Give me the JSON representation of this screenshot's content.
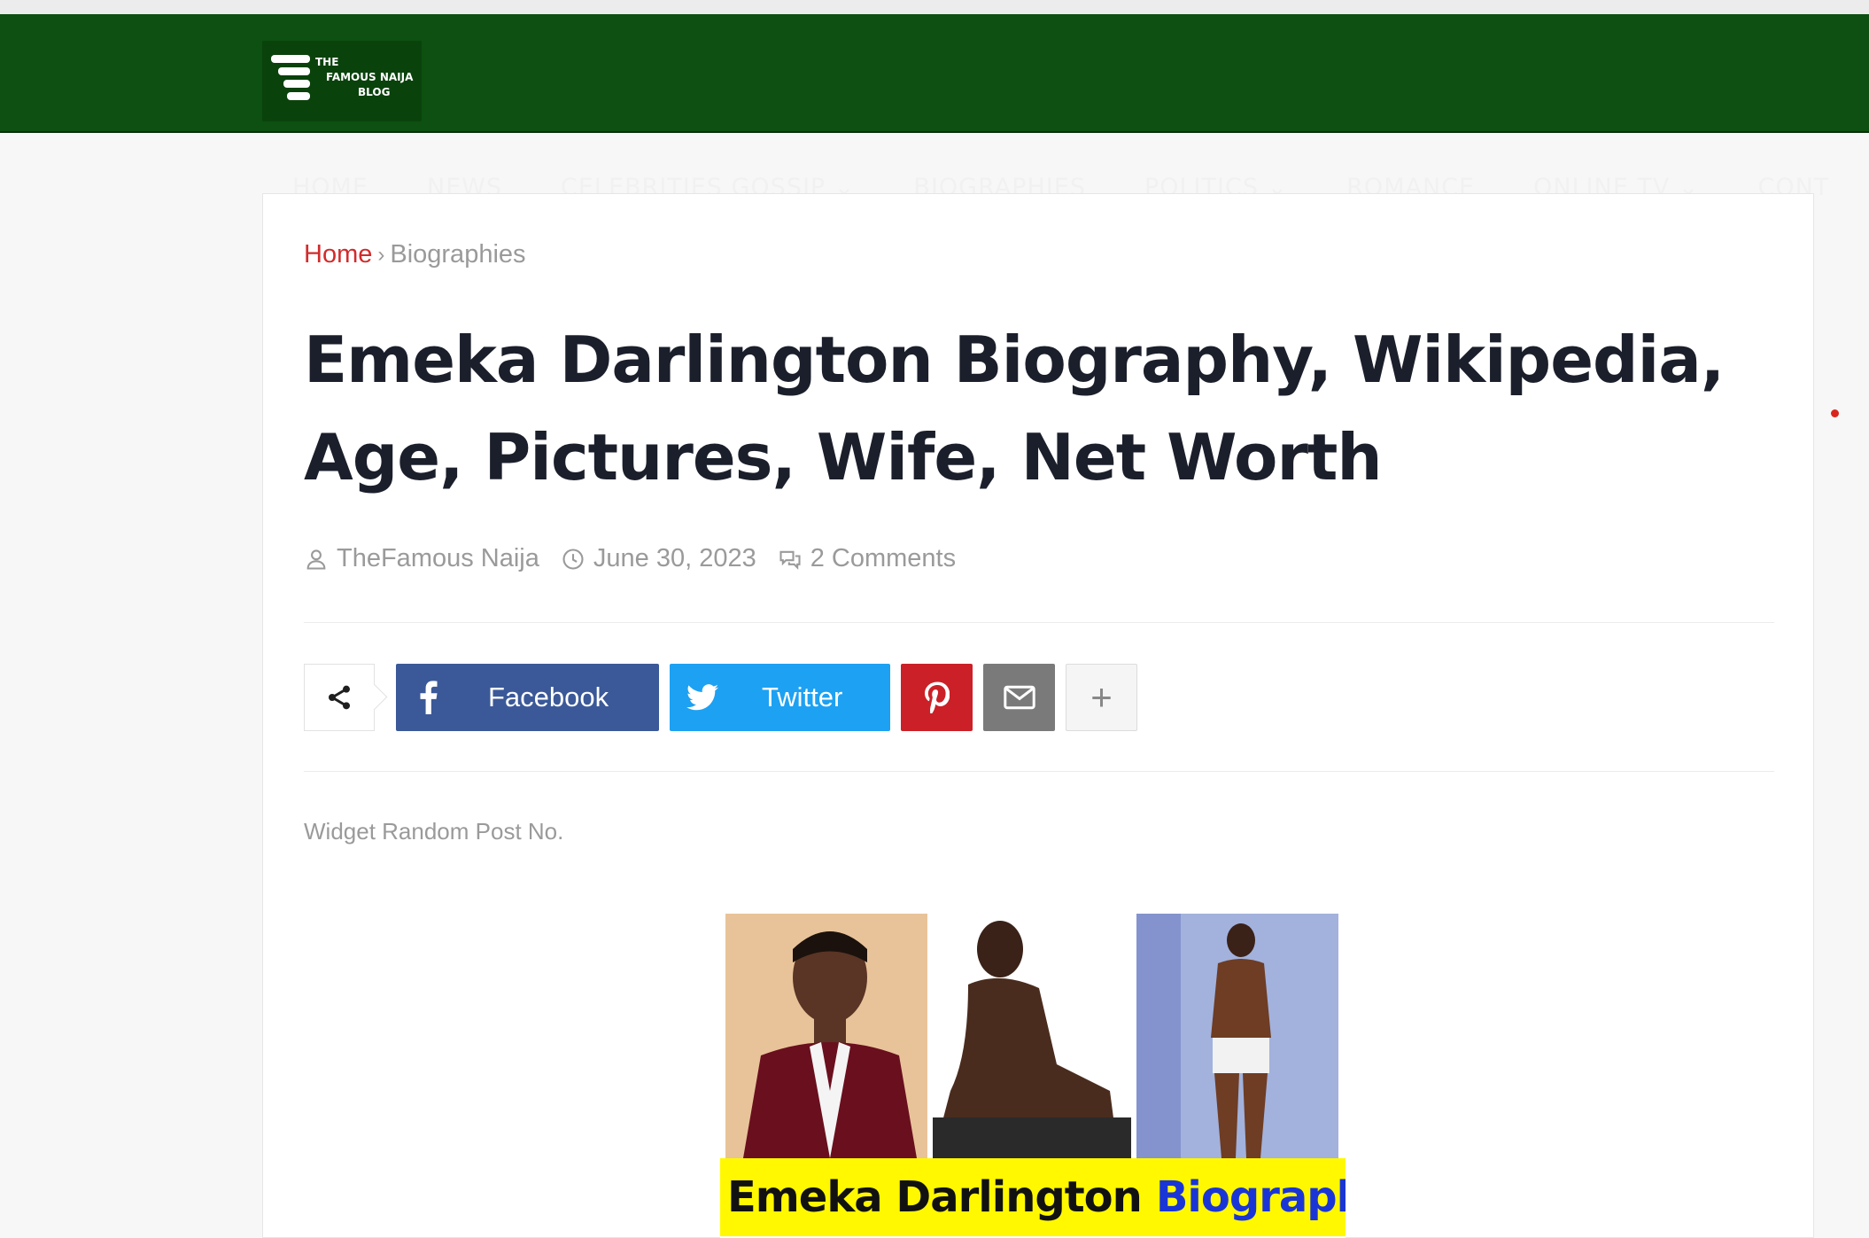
{
  "site": {
    "logo_line1": "THE",
    "logo_line2": "FAMOUS NAIJA",
    "logo_line3": "BLOG"
  },
  "nav": {
    "items": [
      "HOME",
      "NEWS",
      "CELEBRITIES GOSSIP ⌄",
      "BIOGRAPHIES",
      "POLITICS ⌄",
      "ROMANCE",
      "ONLINE TV ⌄",
      "CONT"
    ]
  },
  "breadcrumb": {
    "home": "Home",
    "separator": "›",
    "current": "Biographies"
  },
  "post": {
    "title": "Emeka Darlington Biography, Wikipedia, Age, Pictures, Wife, Net Worth",
    "author": "TheFamous Naija",
    "date": "June 30, 2023",
    "comments": "2 Comments"
  },
  "share": {
    "facebook_label": "Facebook",
    "twitter_label": "Twitter",
    "more_label": "+"
  },
  "widget_note": "Widget Random Post No.",
  "featured": {
    "banner_part1": "Emeka Darlington",
    "banner_part2": "Biography"
  },
  "colors": {
    "header_green": "#0d5011",
    "accent_red": "#d22b2b",
    "facebook": "#3b5998",
    "twitter": "#1da1f2",
    "pinterest": "#cb2027",
    "banner_yellow": "#fff800",
    "banner_blue": "#1a35d6"
  }
}
